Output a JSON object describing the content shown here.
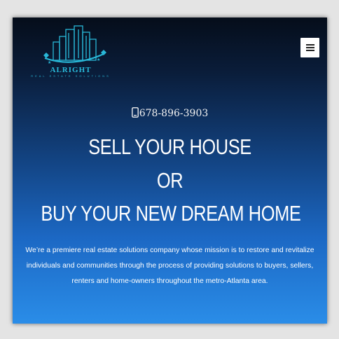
{
  "logo": {
    "name": "ALRIGHT",
    "tagline": "REAL ESTATE SOLUTIONS",
    "accent_color": "#29b8d8"
  },
  "header": {
    "menu_icon": "hamburger-icon"
  },
  "hero": {
    "phone_icon": "phone-icon",
    "phone": "678-896-3903",
    "headline_line1": "SELL YOUR HOUSE",
    "headline_line2": "OR",
    "headline_line3": "BUY YOUR NEW DREAM HOME",
    "description": "We’re a premiere real estate solutions company whose mission is to restore and revitalize individuals and communities through the process of providing solutions to buyers, sellers, renters and home-owners throughout the metro-Atlanta area."
  },
  "colors": {
    "gradient_top": "#050d1a",
    "gradient_bottom": "#2a8de8",
    "text": "#ffffff"
  }
}
